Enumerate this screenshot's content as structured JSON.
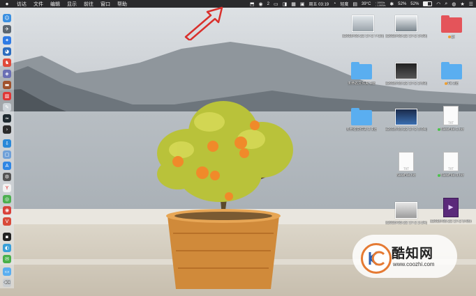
{
  "menubar": {
    "app_menus": [
      "访达",
      "文件",
      "编辑",
      "显示",
      "前往",
      "窗口",
      "帮助"
    ],
    "wechat_count": "2",
    "net_up": "↑ 10KB/s",
    "net_down": "↓ 1.0KB/s",
    "clock": "周五 03:19",
    "input_method": "轻度",
    "cpu_percent": "52%",
    "battery_percent": "52%",
    "battery_level": 0.52,
    "temp": "39°C"
  },
  "desktop": {
    "icons": [
      {
        "kind": "thumb",
        "label": "a2018-03-22 17-2 7-18.jpg"
      },
      {
        "kind": "thumb",
        "label": "a2018-03-22 17-2 3-59.jpg"
      },
      {
        "kind": "folder-red",
        "label": "gs"
      },
      {
        "kind": "folder",
        "label": "未命名文件夹 1道"
      },
      {
        "kind": "thumb",
        "label": "a2018-03-22 17-2 2-59.jpg"
      },
      {
        "kind": "folder",
        "label": "Pa 2道"
      },
      {
        "kind": "folder",
        "label": "未命名文件夹 2 1道"
      },
      {
        "kind": "thumb",
        "label": "a2018-03-22 17-2 3-04.jpg"
      },
      {
        "kind": "doc",
        "label": "NewFile-1.txt"
      },
      {
        "kind": "doc",
        "label": "NewFile.txt"
      },
      {
        "kind": "doc",
        "label": "NewFile-3.txt"
      },
      {
        "kind": "thumb",
        "label": "a2018-03-22 17-2 2-24.jpg"
      },
      {
        "kind": "video",
        "label": "a2018-03-22 17-2 5-05.mp4"
      }
    ]
  },
  "watermark": {
    "name": "酷知网",
    "url": "www.coozhi.com"
  },
  "colors": {
    "menubar_bg": "#2a2a2c",
    "folder_blue": "#5aaef0",
    "folder_red": "#e4545a",
    "arrow_red": "#d9302c",
    "watermark_orange": "#e57a33"
  }
}
